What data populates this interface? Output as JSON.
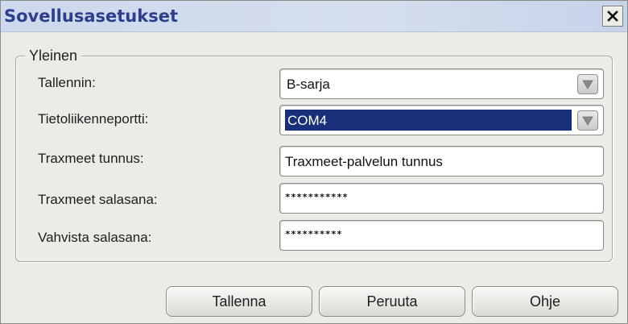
{
  "window": {
    "title": "Sovellusasetukset",
    "close_icon": "close-x-icon"
  },
  "group": {
    "legend": "Yleinen"
  },
  "fields": {
    "recorder": {
      "label": "Tallennin:",
      "value": "B-sarja",
      "icon": "dropdown-arrow-icon"
    },
    "comm_port": {
      "label": "Tietoliikenneportti:",
      "value": "COM4",
      "icon": "dropdown-arrow-icon"
    },
    "traxmeet_id": {
      "label": "Traxmeet tunnus:",
      "value": "Traxmeet-palvelun tunnus"
    },
    "traxmeet_password": {
      "label": "Traxmeet salasana:",
      "value": "***********"
    },
    "confirm_password": {
      "label": "Vahvista salasana:",
      "value": "**********"
    }
  },
  "buttons": {
    "save": "Tallenna",
    "cancel": "Peruuta",
    "help": "Ohje"
  },
  "colors": {
    "title_text": "#2c3f8c",
    "selection": "#1a2f7a",
    "dialog_bg": "#ecebe6"
  }
}
